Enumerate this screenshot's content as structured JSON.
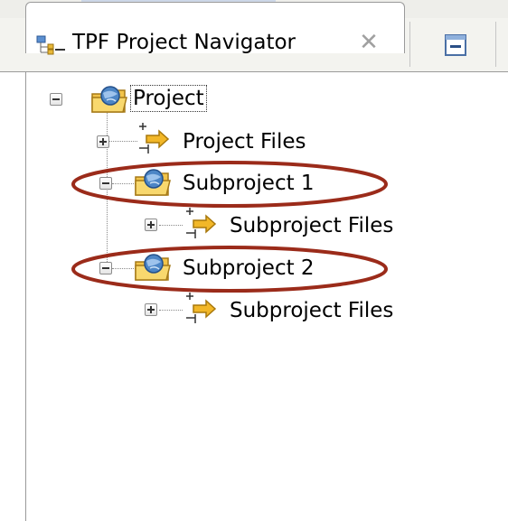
{
  "view": {
    "title": "TPF Project Navigator",
    "icons": {
      "tab": "navigator-icon",
      "close": "close-icon",
      "collapse": "collapse-all-icon"
    },
    "close_glyph": "✕"
  },
  "tree": {
    "root": {
      "label": "Project",
      "icon": "project-folder-icon",
      "expanded": true,
      "selected": true
    },
    "project_files": {
      "label": "Project Files",
      "icon": "filter-arrow-icon",
      "expanded": false
    },
    "subproject1": {
      "label": "Subproject 1",
      "icon": "project-folder-icon",
      "expanded": true,
      "highlighted": true
    },
    "subproject1_files": {
      "label": "Subproject Files",
      "icon": "filter-arrow-icon",
      "expanded": false
    },
    "subproject2": {
      "label": "Subproject 2",
      "icon": "project-folder-icon",
      "expanded": true,
      "highlighted": true
    },
    "subproject2_files": {
      "label": "Subproject Files",
      "icon": "filter-arrow-icon",
      "expanded": false
    }
  },
  "colors": {
    "highlight_ellipse": "#9b2b1a",
    "folder": "#f0c040",
    "globe": "#4d86c6",
    "arrow": "#f2b728"
  }
}
